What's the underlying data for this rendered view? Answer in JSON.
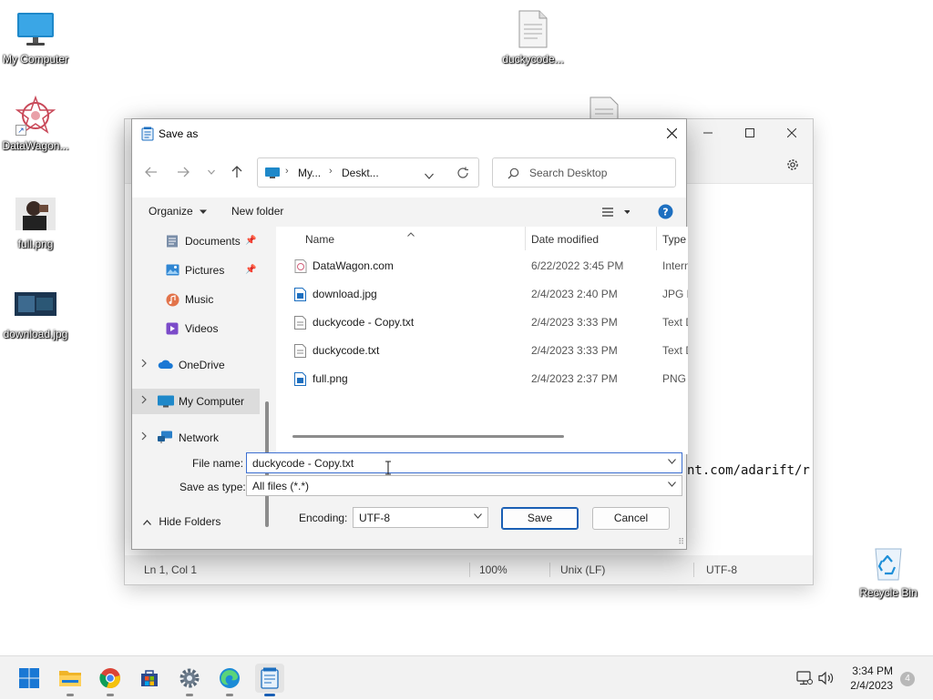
{
  "desktop": {
    "icons": [
      {
        "label": "My Computer"
      },
      {
        "label": "DataWagon..."
      },
      {
        "label": "full.png"
      },
      {
        "label": "download.jpg"
      },
      {
        "label": "duckycode..."
      },
      {
        "label": "Recycle Bin"
      }
    ]
  },
  "notepad": {
    "line_text": "nt.com/adarift/r",
    "status": {
      "position": "Ln 1, Col 1",
      "zoom": "100%",
      "line_ending": "Unix (LF)",
      "encoding": "UTF-8"
    }
  },
  "dialog": {
    "title": "Save as",
    "address": {
      "crumb1": "My...",
      "crumb2": "Deskt..."
    },
    "search_placeholder": "Search Desktop",
    "toolbar": {
      "organize": "Organize",
      "new_folder": "New folder"
    },
    "nav": [
      {
        "label": "Documents"
      },
      {
        "label": "Pictures"
      },
      {
        "label": "Music"
      },
      {
        "label": "Videos"
      },
      {
        "label": "OneDrive"
      },
      {
        "label": "My Computer"
      },
      {
        "label": "Network"
      }
    ],
    "columns": {
      "name": "Name",
      "date": "Date modified",
      "type": "Type"
    },
    "files": [
      {
        "name": "DataWagon.com",
        "date": "6/22/2022 3:45 PM",
        "type": "Intern"
      },
      {
        "name": "download.jpg",
        "date": "2/4/2023 2:40 PM",
        "type": "JPG F"
      },
      {
        "name": "duckycode - Copy.txt",
        "date": "2/4/2023 3:33 PM",
        "type": "Text D"
      },
      {
        "name": "duckycode.txt",
        "date": "2/4/2023 3:33 PM",
        "type": "Text D"
      },
      {
        "name": "full.png",
        "date": "2/4/2023 2:37 PM",
        "type": "PNG"
      }
    ],
    "file_name_label": "File name:",
    "file_name_value": "duckycode - Copy.txt",
    "save_type_label": "Save as type:",
    "save_type_value": "All files  (*.*)",
    "hide_folders": "Hide Folders",
    "encoding_label": "Encoding:",
    "encoding_value": "UTF-8",
    "save_label": "Save",
    "cancel_label": "Cancel"
  },
  "taskbar": {
    "time": "3:34 PM",
    "date": "2/4/2023",
    "notifications": "4"
  },
  "colors": {
    "accent": "#1a5fb4",
    "selection": "#dcdcdc"
  }
}
